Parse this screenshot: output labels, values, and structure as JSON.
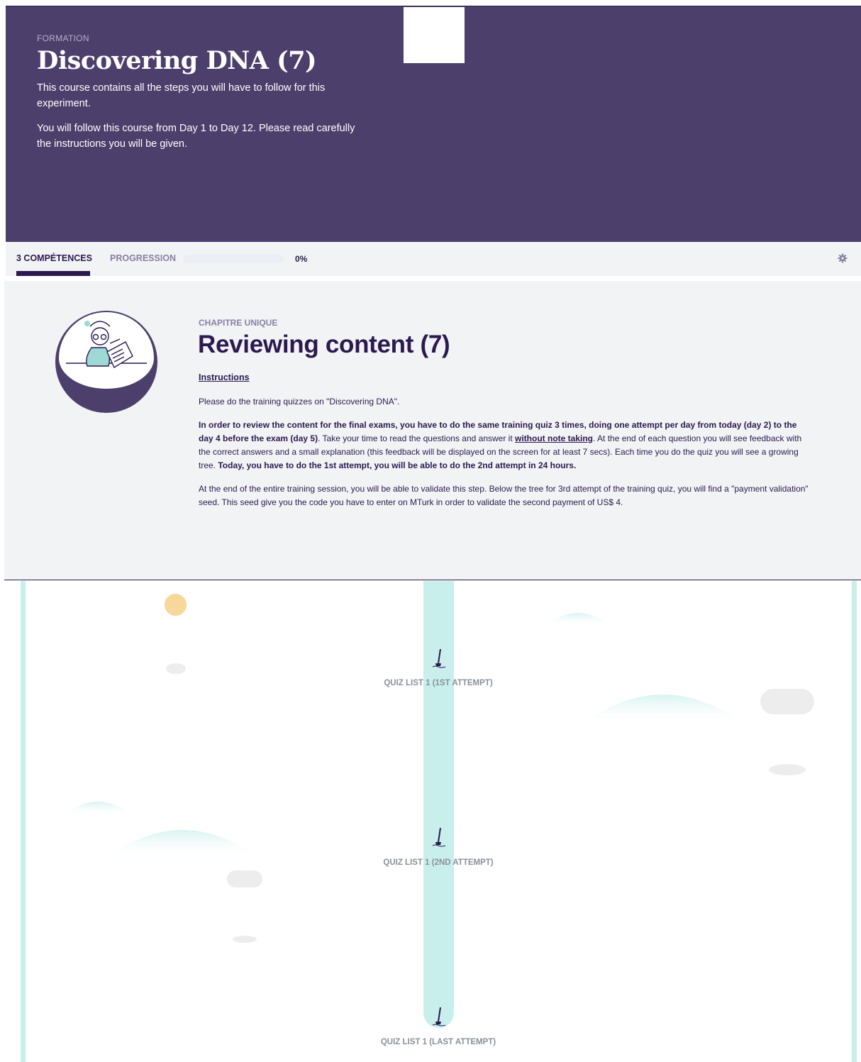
{
  "header": {
    "eyebrow": "FORMATION",
    "title": "Discovering DNA (7)",
    "paragraph_1": "This course contains all the steps you will have to follow for this experiment.",
    "paragraph_2": "You will follow this course from Day 1 to Day 12. Please read carefully the instructions you will be given."
  },
  "tabs": {
    "competences_label": "3 COMPÉTENCES",
    "progression_label": "PROGRESSION",
    "progress_value": 0,
    "progress_text": "0%"
  },
  "chapter": {
    "eyebrow": "CHAPITRE UNIQUE",
    "title": "Reviewing content (7)",
    "instructions_link": "Instructions",
    "p1": "Please do the training quizzes on \"Discovering DNA\".",
    "p2_bold_1": "In order to review the content for the final exams, you have to do the same training quiz 3 times, doing one attempt per day from today (day 2) to the day 4 before the exam (day 5)",
    "p2_text_1": ". Take your time to read the questions and answer it ",
    "p2_underline": "without note taking",
    "p2_text_2": ". At the end of each question you will see feedback with the correct answers and  a small explanation (this feedback will be displayed on the screen for at least 7 secs). Each time you do the quiz you will see a growing tree. ",
    "p2_bold_2": "Today, you have to do the 1st attempt, you will be able to do the 2nd attempt in 24 hours.",
    "p3": "At the end of the entire training session, you will be able to validate this step. Below the tree for 3rd attempt of the training quiz, you will find a \"payment validation\" seed. This seed give you the code you have to enter on MTurk in order to validate the second payment of US$ 4."
  },
  "quiz_nodes": [
    {
      "label": "QUIZ LIST 1 (1ST ATTEMPT)",
      "icon": "sprout-icon"
    },
    {
      "label": "QUIZ LIST 1 (2ND ATTEMPT)",
      "icon": "sprout-icon"
    },
    {
      "label": "QUIZ LIST 1 (LAST ATTEMPT)",
      "icon": "sprout-icon"
    }
  ],
  "colors": {
    "brand_purple": "#4d3f6b",
    "dark_navy": "#2b1a4e",
    "stem_teal": "#c9efec",
    "sun": "#f7d79a"
  }
}
